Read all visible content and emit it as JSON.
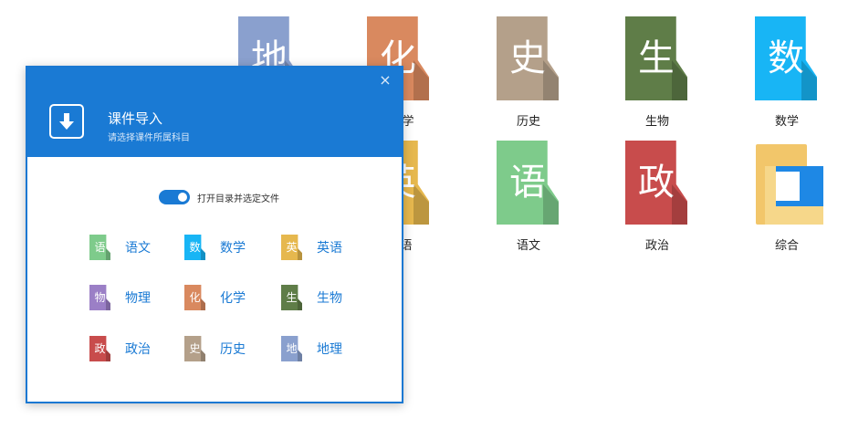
{
  "background_icons": [
    {
      "char": "地",
      "label": "",
      "color": "#8aa0ce"
    },
    {
      "char": "化",
      "label": "学",
      "color": "#d9895f"
    },
    {
      "char": "史",
      "label": "历史",
      "color": "#b4a08a"
    },
    {
      "char": "生",
      "label": "生物",
      "color": "#5f7d48"
    },
    {
      "char": "数",
      "label": "数学",
      "color": "#18b5f5"
    },
    {
      "char": "英",
      "label": "语",
      "color": "#e6b84e"
    },
    {
      "char": "语",
      "label": "语文",
      "color": "#7ecb8b"
    },
    {
      "char": "政",
      "label": "政治",
      "color": "#c84c4c"
    }
  ],
  "folder": {
    "label": "综合"
  },
  "dialog": {
    "close_icon": "×",
    "title": "课件导入",
    "subtitle": "请选择课件所属科目",
    "toggle_label": "打开目录并选定文件",
    "subjects": [
      {
        "char": "语",
        "name": "语文",
        "color": "#7ecb8b"
      },
      {
        "char": "数",
        "name": "数学",
        "color": "#18b5f5"
      },
      {
        "char": "英",
        "name": "英语",
        "color": "#e6b84e"
      },
      {
        "char": "物",
        "name": "物理",
        "color": "#9b7fc6"
      },
      {
        "char": "化",
        "name": "化学",
        "color": "#d9895f"
      },
      {
        "char": "生",
        "name": "生物",
        "color": "#5f7d48"
      },
      {
        "char": "政",
        "name": "政治",
        "color": "#c84c4c"
      },
      {
        "char": "史",
        "name": "历史",
        "color": "#b4a08a"
      },
      {
        "char": "地",
        "name": "地理",
        "color": "#8aa0ce"
      }
    ]
  }
}
